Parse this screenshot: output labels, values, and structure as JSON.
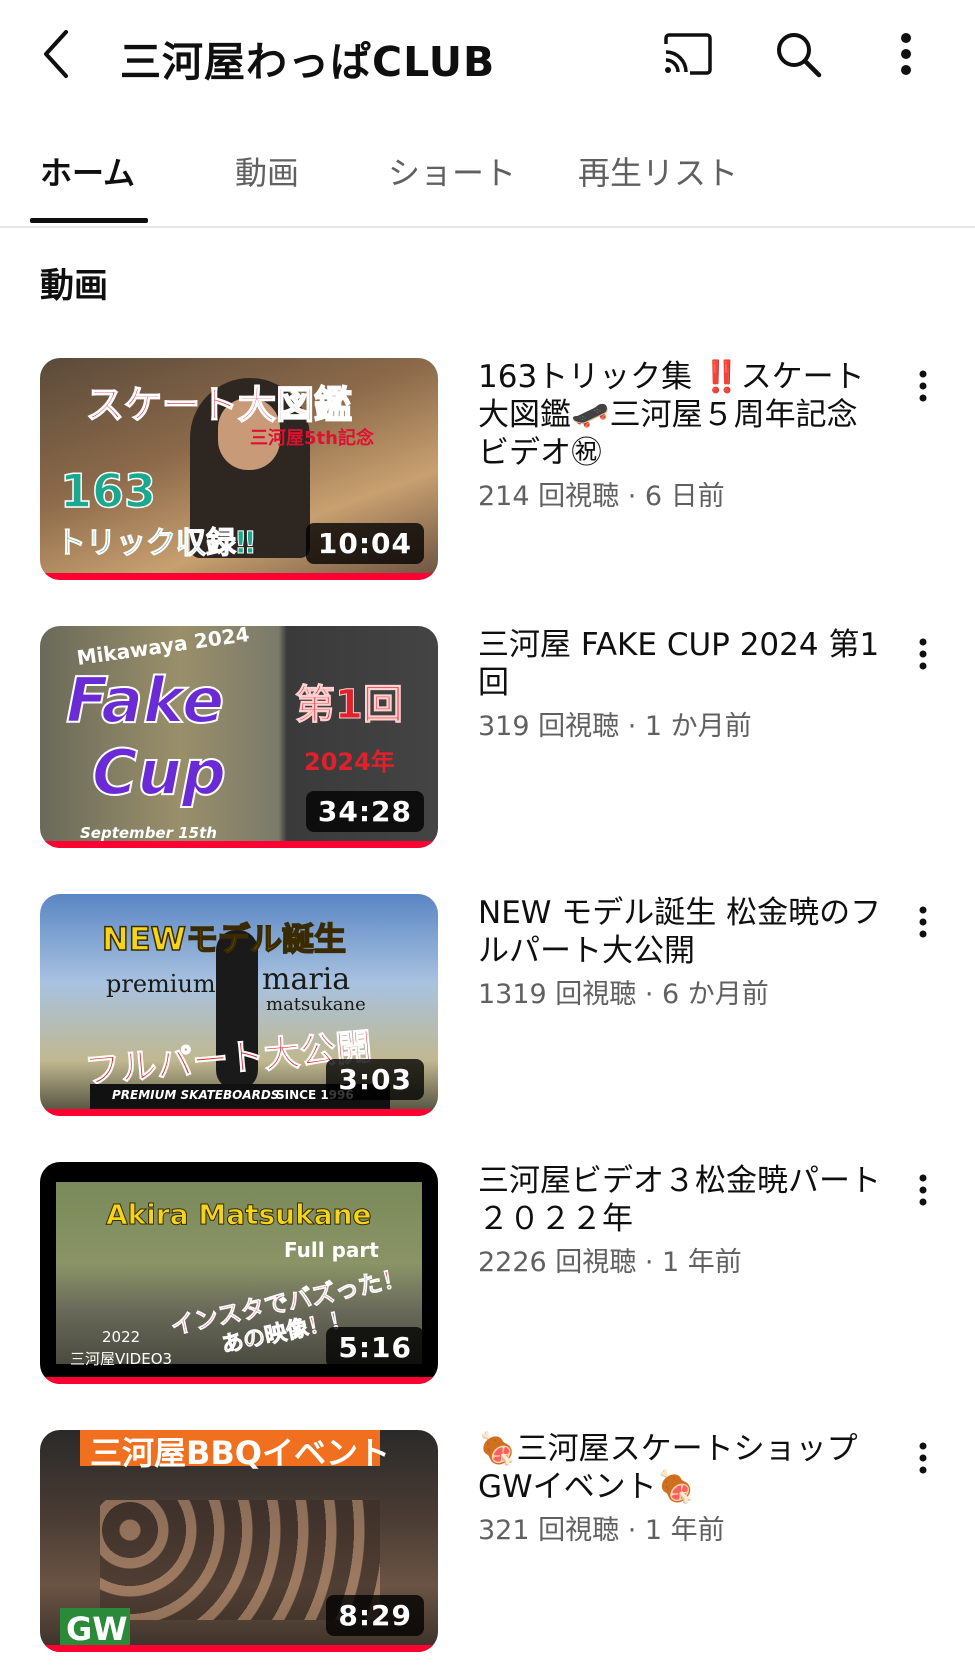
{
  "header": {
    "channel_name": "三河屋わっぱCLUB",
    "icons": [
      "back-arrow-icon",
      "cast-icon",
      "search-icon",
      "more-vert-icon"
    ]
  },
  "tabs": [
    {
      "label": "ホーム",
      "active": true
    },
    {
      "label": "動画",
      "active": false
    },
    {
      "label": "ショート",
      "active": false
    },
    {
      "label": "再生リスト",
      "active": false
    }
  ],
  "section": {
    "title": "動画"
  },
  "videos": [
    {
      "title": "163トリック集 ‼️スケート大図鑑🛹三河屋５周年記念ビデオ㊗",
      "views": "214 回視聴",
      "age": "6 日前",
      "duration": "10:04",
      "thumb_texts": [
        "スケート大図鑑",
        "三河屋5th記念",
        "163",
        "トリック収録‼"
      ]
    },
    {
      "title": "三河屋 FAKE CUP 2024 第1回",
      "views": "319 回視聴",
      "age": "1 か月前",
      "duration": "34:28",
      "thumb_texts": [
        "Mikawaya 2024",
        "Fake",
        "Cup",
        "第1回",
        "2024年",
        "September 15th"
      ]
    },
    {
      "title": "NEW モデル誕生 松金暁のフルパート大公開",
      "views": "1319 回視聴",
      "age": "6 か月前",
      "duration": "3:03",
      "thumb_texts": [
        "NEWモデル誕生",
        "premium",
        "maria",
        "matsukane",
        "フルパート大公開",
        "PREMIUM SKATEBOARDS",
        "SINCE 1996"
      ]
    },
    {
      "title": "三河屋ビデオ３松金暁パート２０２２年",
      "views": "2226 回視聴",
      "age": "1 年前",
      "duration": "5:16",
      "thumb_texts": [
        "Akira Matsukane",
        "Full part",
        "インスタでバズった！",
        "あの映像！！",
        "2022",
        "三河屋VIDEO3"
      ]
    },
    {
      "title": "🍖三河屋スケートショップGWイベント🍖",
      "views": "321 回視聴",
      "age": "1 年前",
      "duration": "8:29",
      "thumb_texts": [
        "三河屋BBQイベント",
        "GW"
      ]
    }
  ],
  "meta_separator": " · ",
  "colors": {
    "accent_red": "#ff0033",
    "text_primary": "#0f0f0f",
    "text_secondary": "#606060"
  }
}
